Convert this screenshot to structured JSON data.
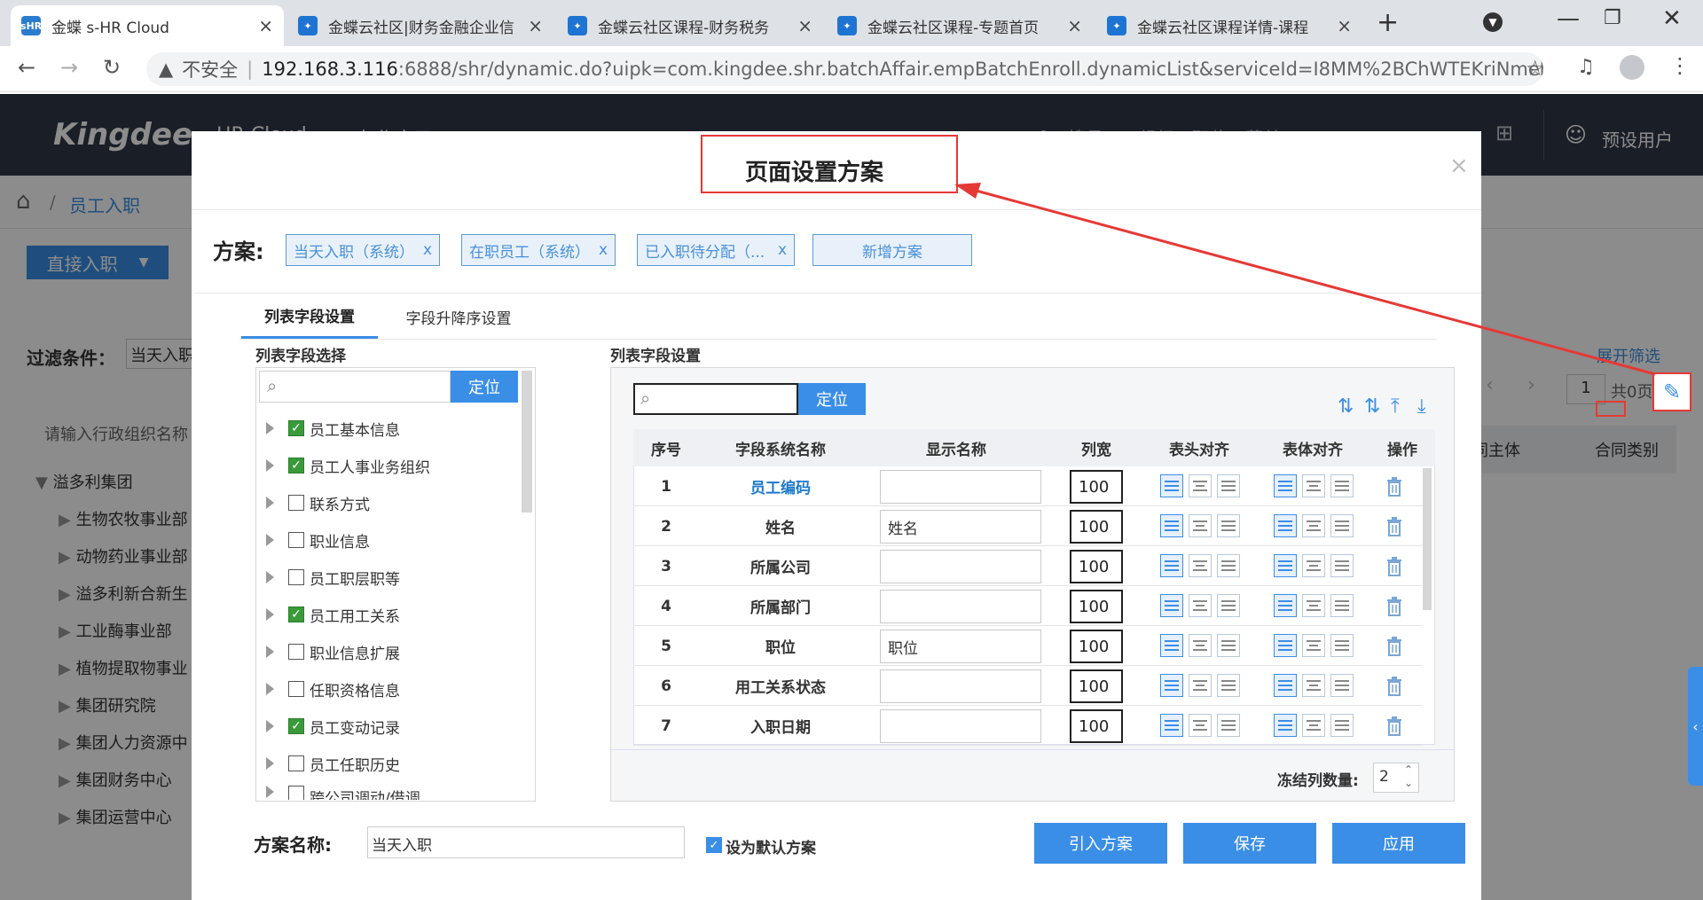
{
  "browser": {
    "tabs": [
      {
        "title": "金蝶 s-HR Cloud",
        "favicon": "sHR",
        "close": "×"
      },
      {
        "title": "金蝶云社区|财务金融企业信",
        "close": "×"
      },
      {
        "title": "金蝶云社区课程-财务税务",
        "close": "×"
      },
      {
        "title": "金蝶云社区课程-专题首页",
        "close": "×"
      },
      {
        "title": "金蝶云社区课程详情-课程",
        "close": "×"
      }
    ],
    "new_tab": "+",
    "insecure_label": "不安全",
    "url_host": "192.168.3.116",
    "url_rest": ":6888/shr/dynamic.do?uipk=com.kingdee.shr.batchAffair.empBatchEnroll.dynamicList&serviceId=I8MM%2BChWTEKriNmeh..."
  },
  "app": {
    "brand": "Kingdee",
    "product": "HR Cloud",
    "nav_item": "专业应用",
    "search_placeholder": "搜员工、组织、职位、菜单",
    "user": "预设用户",
    "breadcrumb": "员工入职",
    "primary_button": "直接入职",
    "filter_label": "过滤条件：",
    "filter_value": "当天入职",
    "org_search_placeholder": "请输入行政组织名称",
    "expand_filter": "展开筛选",
    "pager_value": "1",
    "pager_total": "共0页",
    "org_tree": [
      "溢多利集团",
      "生物农牧事业部",
      "动物药业事业部",
      "溢多利新合新生",
      "工业酶事业部",
      "植物提取物事业",
      "集团研究院",
      "集团人力资源中",
      "集团财务中心",
      "集团运营中心"
    ],
    "grid_headers": [
      "同主体",
      "合同类别"
    ]
  },
  "modal": {
    "title": "页面设置方案",
    "close": "×",
    "scheme_label": "方案:",
    "schemes": [
      "当天入职（系统）",
      "在职员工（系统）",
      "已入职待分配（..."
    ],
    "scheme_remove": "x",
    "add_scheme": "新增方案",
    "tabs": [
      "列表字段设置",
      "字段升降序设置"
    ],
    "left_title": "列表字段选择",
    "locate": "定位",
    "field_tree": [
      {
        "label": "员工基本信息",
        "checked": true
      },
      {
        "label": "员工人事业务组织",
        "checked": true
      },
      {
        "label": "联系方式",
        "checked": false
      },
      {
        "label": "职业信息",
        "checked": false
      },
      {
        "label": "员工职层职等",
        "checked": false
      },
      {
        "label": "员工用工关系",
        "checked": true
      },
      {
        "label": "职业信息扩展",
        "checked": false
      },
      {
        "label": "任职资格信息",
        "checked": false
      },
      {
        "label": "员工变动记录",
        "checked": true
      },
      {
        "label": "员工任职历史",
        "checked": false
      },
      {
        "label": "跨公司调动/借调",
        "checked": false
      }
    ],
    "right_title": "列表字段设置",
    "columns": [
      "序号",
      "字段系统名称",
      "显示名称",
      "列宽",
      "表头对齐",
      "表体对齐",
      "操作"
    ],
    "rows": [
      {
        "no": "1",
        "name": "员工编码",
        "display": "",
        "width": "100",
        "link": true
      },
      {
        "no": "2",
        "name": "姓名",
        "display": "姓名",
        "width": "100"
      },
      {
        "no": "3",
        "name": "所属公司",
        "display": "",
        "width": "100"
      },
      {
        "no": "4",
        "name": "所属部门",
        "display": "",
        "width": "100"
      },
      {
        "no": "5",
        "name": "职位",
        "display": "职位",
        "width": "100"
      },
      {
        "no": "6",
        "name": "用工关系状态",
        "display": "",
        "width": "100"
      },
      {
        "no": "7",
        "name": "入职日期",
        "display": "",
        "width": "100"
      }
    ],
    "freeze_label": "冻结列数量:",
    "freeze_value": "2",
    "scheme_name_label": "方案名称:",
    "scheme_name_value": "当天入职",
    "default_label": "设为默认方案",
    "import_btn": "引入方案",
    "save_btn": "保存",
    "apply_btn": "应用"
  },
  "colors": {
    "accent": "#3a8ee6",
    "annotation": "#e53935",
    "appbar": "#2f3847"
  }
}
